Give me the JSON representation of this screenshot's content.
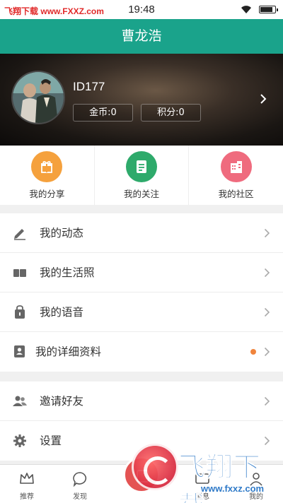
{
  "status_bar": {
    "watermark": "飞翔下载",
    "watermark_url": "www.FXXZ.com",
    "time": "19:48",
    "battery_level": 0.9
  },
  "header": {
    "title": "曹龙浩"
  },
  "profile": {
    "user_id": "ID177",
    "coins": "金币:0",
    "points": "积分:0"
  },
  "shortcuts": [
    {
      "label": "我的分享",
      "color": "#f5a13d",
      "icon": "gift-icon"
    },
    {
      "label": "我的关注",
      "color": "#2eaa6b",
      "icon": "document-icon"
    },
    {
      "label": "我的社区",
      "color": "#ef6b7e",
      "icon": "building-icon"
    }
  ],
  "menu_group_1": [
    {
      "label": "我的动态",
      "icon": "pencil-icon"
    },
    {
      "label": "我的生活照",
      "icon": "photo-album-icon"
    },
    {
      "label": "我的语音",
      "icon": "voice-bag-icon"
    },
    {
      "label": "我的详细资料",
      "icon": "profile-card-icon",
      "badge_color": "#f0843c"
    }
  ],
  "menu_group_2": [
    {
      "label": "邀请好友",
      "icon": "invite-friends-icon"
    },
    {
      "label": "设置",
      "icon": "gear-icon"
    }
  ],
  "tabbar": {
    "tabs": [
      {
        "label": "推荐",
        "icon": "crown-icon"
      },
      {
        "label": "发现",
        "icon": "chat-bubble-icon"
      },
      {
        "label": "消息",
        "icon": "message-icon"
      },
      {
        "label": "我的",
        "icon": "person-icon"
      }
    ]
  },
  "watermark_overlay": {
    "title": "飞翔下载",
    "url": "www.fxxz.com"
  },
  "colors": {
    "accent": "#1aa38b",
    "badge": "#f0843c"
  }
}
